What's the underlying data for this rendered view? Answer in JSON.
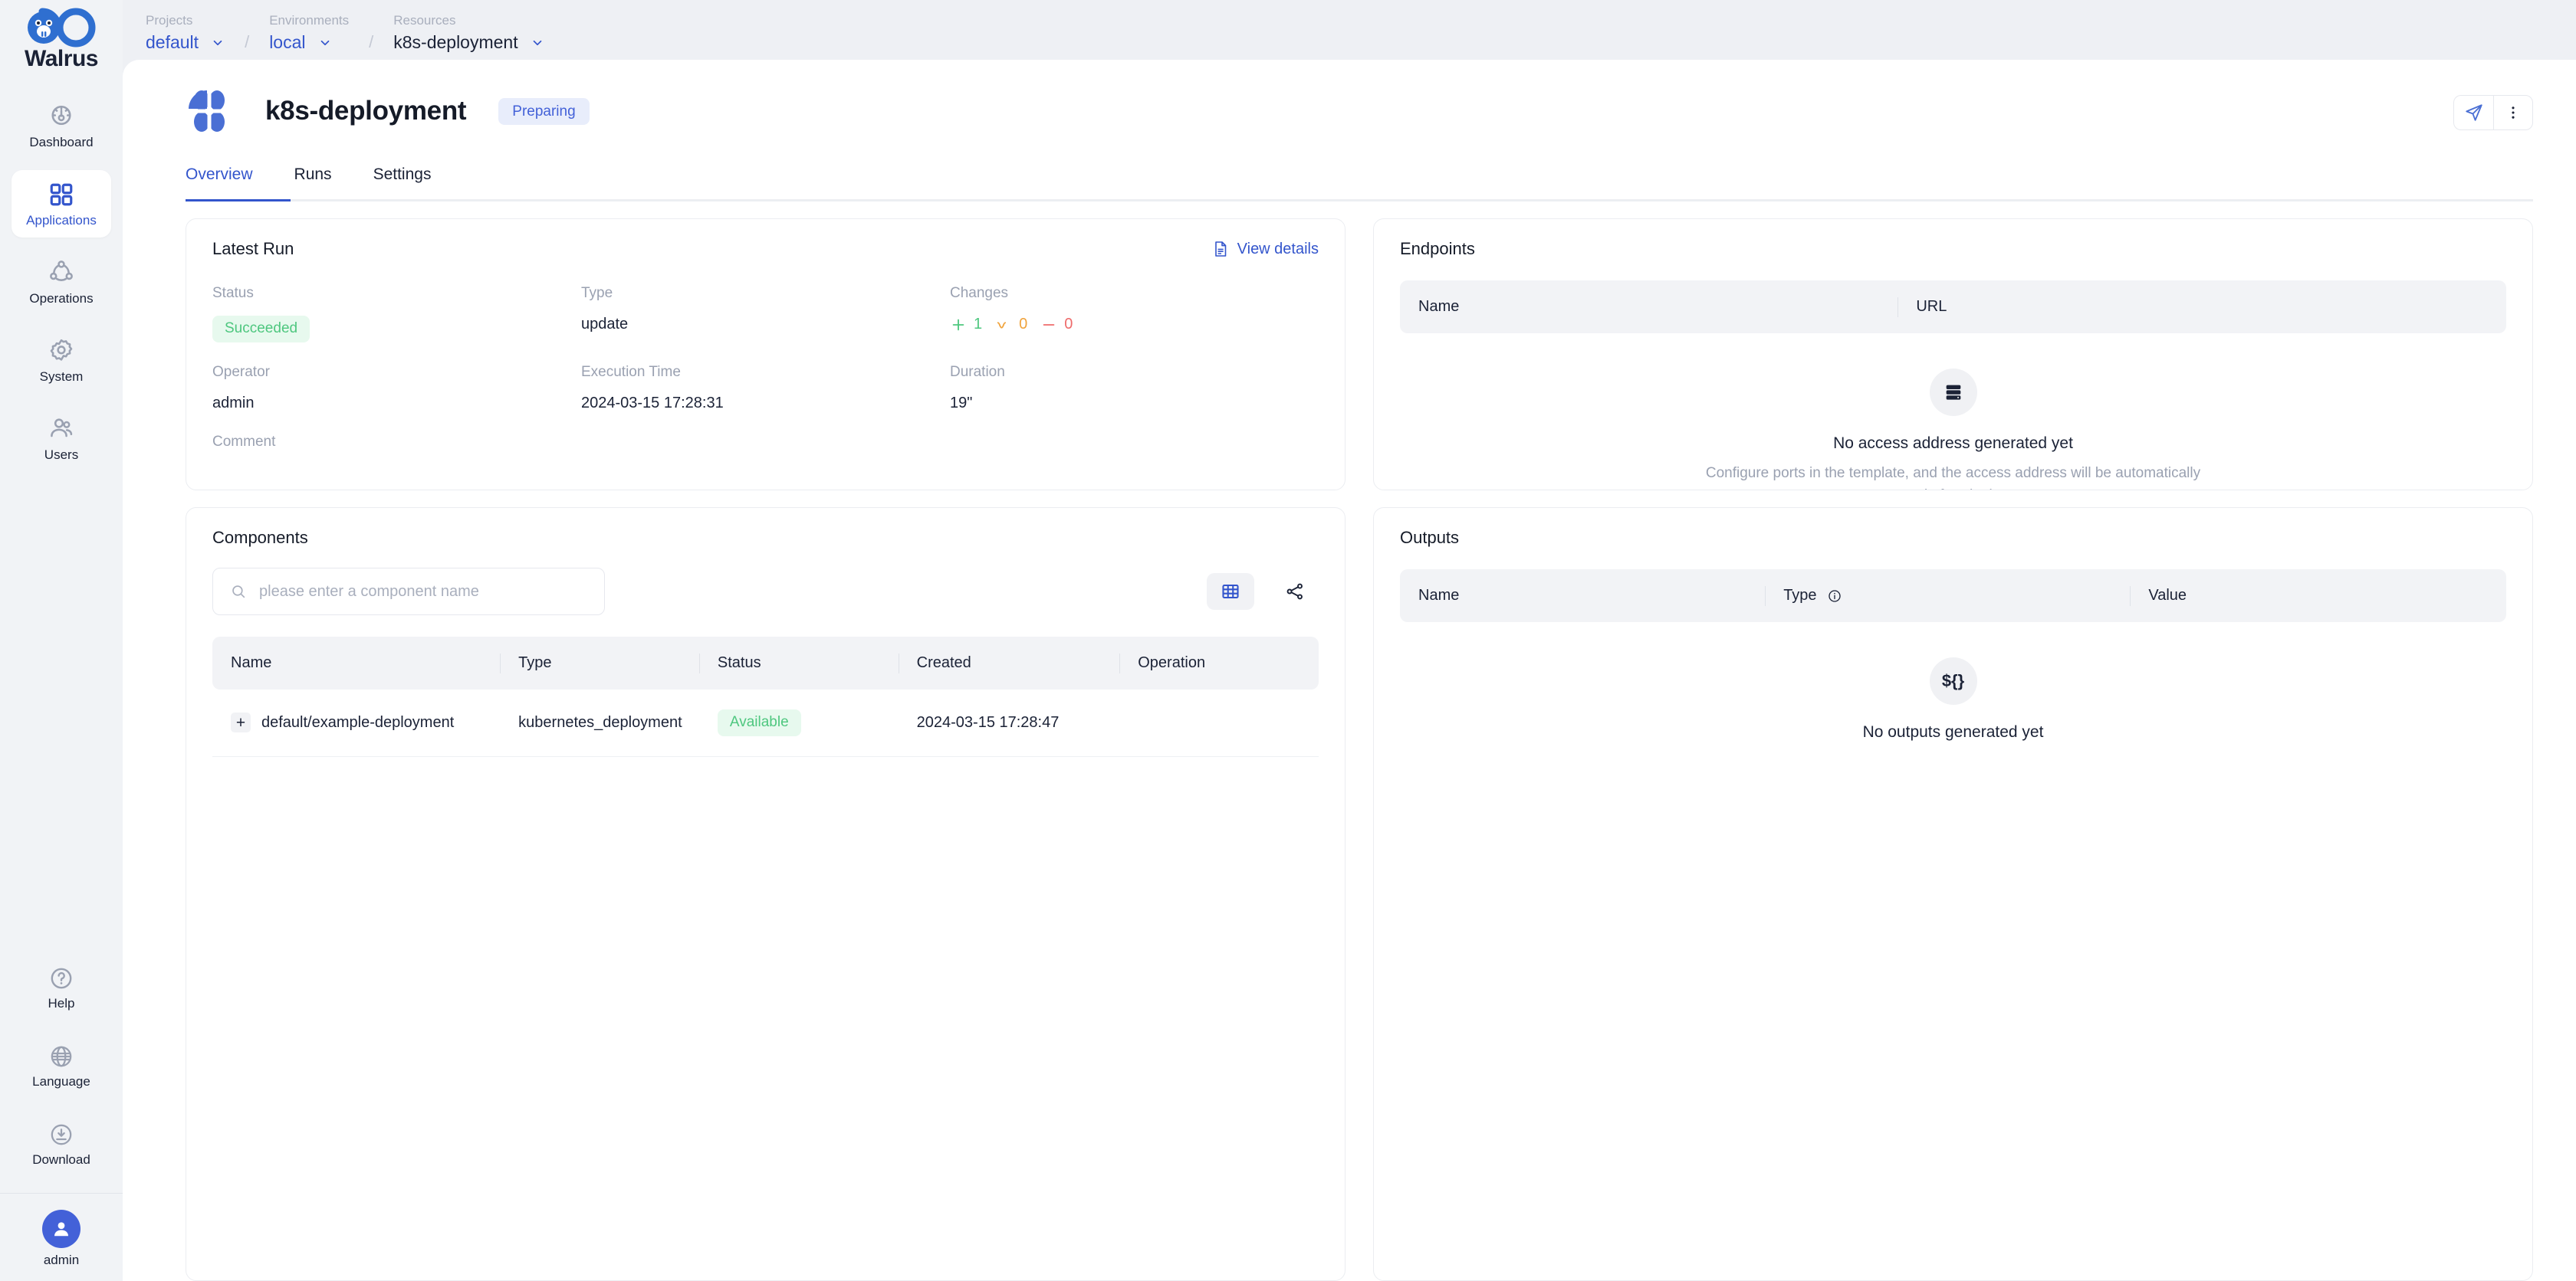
{
  "brand": {
    "name": "Walrus",
    "accent": "#3355cc"
  },
  "sidebar": {
    "items": [
      {
        "label": "Dashboard",
        "icon": "gauge-icon",
        "active": false
      },
      {
        "label": "Applications",
        "icon": "grid-icon",
        "active": true
      },
      {
        "label": "Operations",
        "icon": "share-nodes-icon",
        "active": false
      },
      {
        "label": "System",
        "icon": "gear-icon",
        "active": false
      },
      {
        "label": "Users",
        "icon": "users-icon",
        "active": false
      }
    ],
    "bottom": [
      {
        "label": "Help",
        "icon": "question-circle-icon"
      },
      {
        "label": "Language",
        "icon": "globe-icon"
      },
      {
        "label": "Download",
        "icon": "download-circle-icon"
      }
    ],
    "user": {
      "label": "admin",
      "icon": "avatar-icon"
    }
  },
  "breadcrumb": [
    {
      "label": "Projects",
      "value": "default",
      "icon": "chevron-down-icon"
    },
    {
      "label": "Environments",
      "value": "local",
      "icon": "chevron-down-icon"
    },
    {
      "label": "Resources",
      "value": "k8s-deployment",
      "icon": "chevron-down-icon"
    }
  ],
  "breadcrumb_separator": "/",
  "header": {
    "title": "k8s-deployment",
    "status": "Preparing",
    "app_icon": "flower-app-icon",
    "actions": [
      {
        "name": "deploy-button",
        "icon": "send-icon"
      },
      {
        "name": "more-menu-button",
        "icon": "more-vertical-icon"
      }
    ]
  },
  "tabs": [
    {
      "label": "Overview",
      "active": true
    },
    {
      "label": "Runs",
      "active": false
    },
    {
      "label": "Settings",
      "active": false
    }
  ],
  "latest_run": {
    "title": "Latest Run",
    "view_details": "View details",
    "view_details_icon": "document-icon",
    "fields": {
      "status_label": "Status",
      "status_value": "Succeeded",
      "type_label": "Type",
      "type_value": "update",
      "changes_label": "Changes",
      "changes": {
        "added": "1",
        "modified": "0",
        "deleted": "0"
      },
      "operator_label": "Operator",
      "operator_value": "admin",
      "execution_time_label": "Execution Time",
      "execution_time_value": "2024-03-15 17:28:31",
      "duration_label": "Duration",
      "duration_value": "19\"",
      "comment_label": "Comment",
      "comment_value": ""
    }
  },
  "endpoints": {
    "title": "Endpoints",
    "columns": [
      "Name",
      "URL"
    ],
    "empty_icon": "server-stack-icon",
    "empty_title": "No access address generated yet",
    "empty_sub": "Configure ports in the template, and the access address will be automatically generated after deployment."
  },
  "components": {
    "title": "Components",
    "search_placeholder": "please enter a component name",
    "search_value": "",
    "search_icon": "search-icon",
    "view_toggle": [
      {
        "name": "table-view-button",
        "icon": "table-icon",
        "active": true
      },
      {
        "name": "graph-view-button",
        "icon": "graph-icon",
        "active": false
      }
    ],
    "columns": [
      "Name",
      "Type",
      "Status",
      "Created",
      "Operation"
    ],
    "rows": [
      {
        "name": "default/example-deployment",
        "type": "kubernetes_deployment",
        "status": "Available",
        "created": "2024-03-15 17:28:47",
        "operation": ""
      }
    ]
  },
  "outputs": {
    "title": "Outputs",
    "columns": [
      "Name",
      "Type",
      "Value"
    ],
    "type_info_icon": "info-icon",
    "empty_icon": "variable-icon",
    "empty_glyph": "${}",
    "empty_title": "No outputs generated yet"
  }
}
